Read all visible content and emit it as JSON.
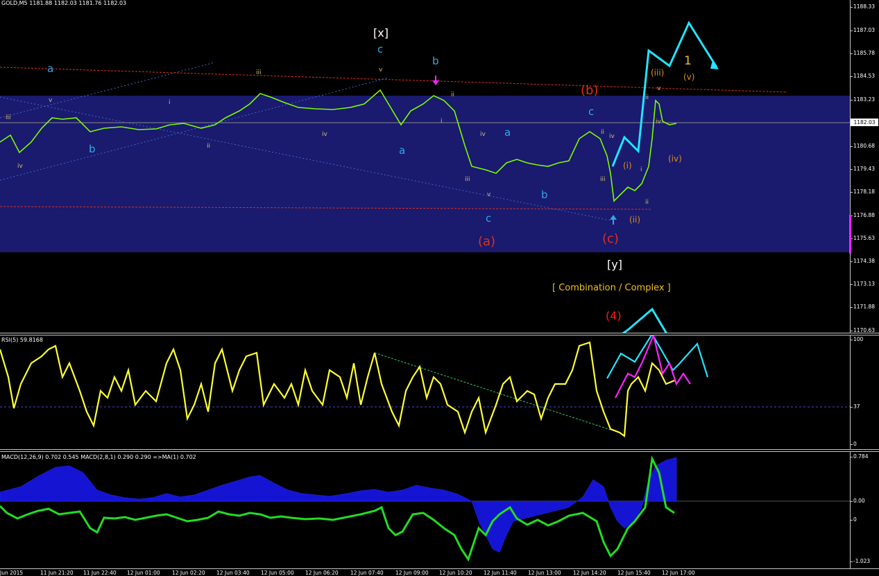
{
  "main": {
    "header": "GOLD,M5  1181.88 1182.03 1181.76 1182.03",
    "price_ticks": [
      "1188.33",
      "1187.03",
      "1185.78",
      "1184.53",
      "1183.23",
      "1182.03",
      "1180.68",
      "1179.43",
      "1178.18",
      "1176.88",
      "1175.63",
      "1174.38",
      "1173.13",
      "1171.88",
      "1170.63"
    ],
    "current_price": "1182.03",
    "labels": {
      "x_bracket": "[x]",
      "y_bracket": "[y]",
      "combination": "[ Combination / Complex ]",
      "wave_4": "(4)",
      "wave_a_paren": "(a)",
      "wave_b_paren": "(b)",
      "wave_c_paren": "(c)",
      "wave_1": "1",
      "wave_i_paren": "(i)",
      "wave_ii_paren": "(ii)",
      "wave_iii_paren": "(iii)",
      "wave_iv_paren": "(iv)",
      "wave_v_paren": "(v)",
      "a": "a",
      "b": "b",
      "c": "c",
      "i": "i",
      "ii": "ii",
      "iii": "iii",
      "iv": "iv",
      "v": "v"
    }
  },
  "rsi": {
    "header": "RSI(5) 59.8168",
    "ticks": [
      "100",
      "37",
      "0"
    ]
  },
  "macd": {
    "header": "MACD(12,26,9) 0.702 0.545   MACD(2,8,1) 0.290 0.290   =>MA(1) 0.702",
    "ticks": [
      "0.784",
      "0.00",
      "0",
      "-1.023"
    ]
  },
  "time_labels": [
    "Jun 2015",
    "11 Jun 21:20",
    "11 Jun 22:40",
    "12 Jun 01:00",
    "12 Jun 02:20",
    "12 Jun 03:40",
    "12 Jun 05:00",
    "12 Jun 06:20",
    "12 Jun 07:40",
    "12 Jun 09:00",
    "12 Jun 10:20",
    "12 Jun 11:40",
    "12 Jun 13:00",
    "12 Jun 14:20",
    "12 Jun 15:40",
    "12 Jun 17:00"
  ],
  "colors": {
    "background": "#000000",
    "zone": "#1a1a6e",
    "candles": "#7cfc00",
    "rsi": "#ffff33",
    "forecast": "#22e5ff",
    "forecast_alt": "#ff22ff",
    "macd_hist": "#1414d2",
    "macd_line": "#22dd22",
    "label_red": "#e0301e",
    "label_blue": "#2fa8e6",
    "label_orange": "#d9901e",
    "label_yellow": "#f0c020"
  }
}
